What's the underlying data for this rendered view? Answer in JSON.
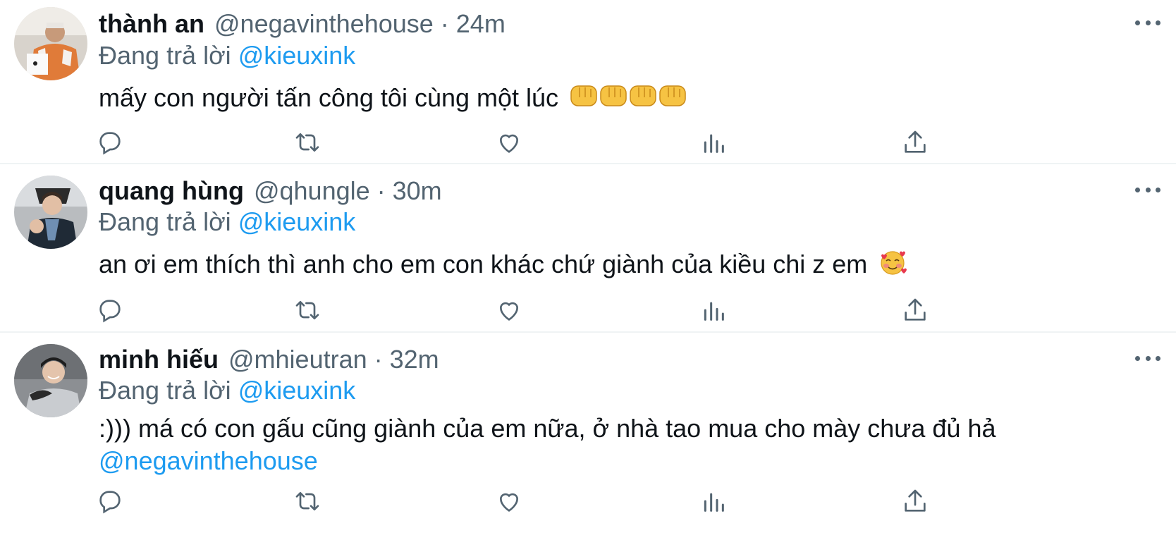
{
  "replying_label": "Đang trả lời",
  "tweets": [
    {
      "name": "thành an",
      "handle": "@negavinthehouse",
      "separator": "·",
      "time": "24m",
      "reply_to": "@kieuxink",
      "text": "mấy con người tấn công tôi cùng một lúc",
      "text_mention": "",
      "emoji": [
        "oncoming-fist-emoji",
        "oncoming-fist-emoji",
        "oncoming-fist-emoji",
        "oncoming-fist-emoji"
      ]
    },
    {
      "name": "quang hùng",
      "handle": "@qhungle",
      "separator": "·",
      "time": "30m",
      "reply_to": "@kieuxink",
      "text": "an ơi em thích thì anh cho em con khác chứ giành của kiều chi z em",
      "text_mention": "",
      "emoji": [
        "smiling-face-with-hearts-emoji"
      ]
    },
    {
      "name": "minh hiếu",
      "handle": "@mhieutran",
      "separator": "·",
      "time": "32m",
      "reply_to": "@kieuxink",
      "text": ":))) má có con gấu cũng giành của em nữa, ở nhà tao mua cho mày chưa đủ hả",
      "text_mention": "@negavinthehouse",
      "emoji": []
    }
  ],
  "actions": [
    "reply-icon",
    "retweet-icon",
    "like-icon",
    "analytics-icon",
    "share-icon"
  ],
  "colors": {
    "text": "#0f1419",
    "secondary": "#536471",
    "link": "#1d9bf0",
    "divider": "#eff3f4"
  }
}
